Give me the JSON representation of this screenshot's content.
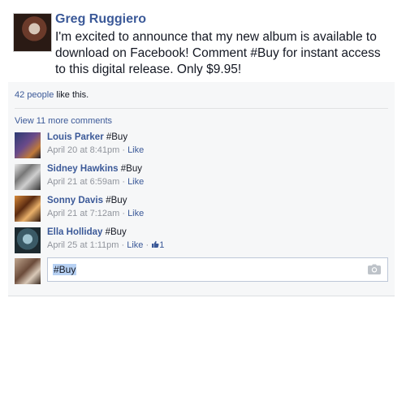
{
  "post": {
    "author": "Greg Ruggiero",
    "text": "I'm excited to announce that my new album is available to download on Facebook! Comment #Buy for instant access to this digital release. Only $9.95!"
  },
  "likes": {
    "count_text": "42 people",
    "suffix": " like this."
  },
  "view_more": "View 11 more comments",
  "comments": [
    {
      "name": "Louis Parker",
      "text": " #Buy",
      "time": "April 20 at 8:41pm",
      "sep": " · ",
      "like": "Like",
      "likes_count": ""
    },
    {
      "name": "Sidney Hawkins",
      "text": " #Buy",
      "time": "April 21 at 6:59am",
      "sep": " · ",
      "like": "Like",
      "likes_count": ""
    },
    {
      "name": "Sonny Davis",
      "text": " #Buy",
      "time": "April 21 at 7:12am",
      "sep": " · ",
      "like": "Like",
      "likes_count": ""
    },
    {
      "name": "Ella Holliday",
      "text": " #Buy",
      "time": "April 25 at 1:11pm",
      "sep": " · ",
      "like": "Like",
      "likes_count": "1"
    }
  ],
  "reply": {
    "value": "#Buy"
  },
  "colors": {
    "link": "#3b5998",
    "meta": "#90949c",
    "ufi_bg": "#f6f7f8"
  },
  "icons": {
    "camera": "camera-icon",
    "thumb": "thumbs-up-icon"
  }
}
